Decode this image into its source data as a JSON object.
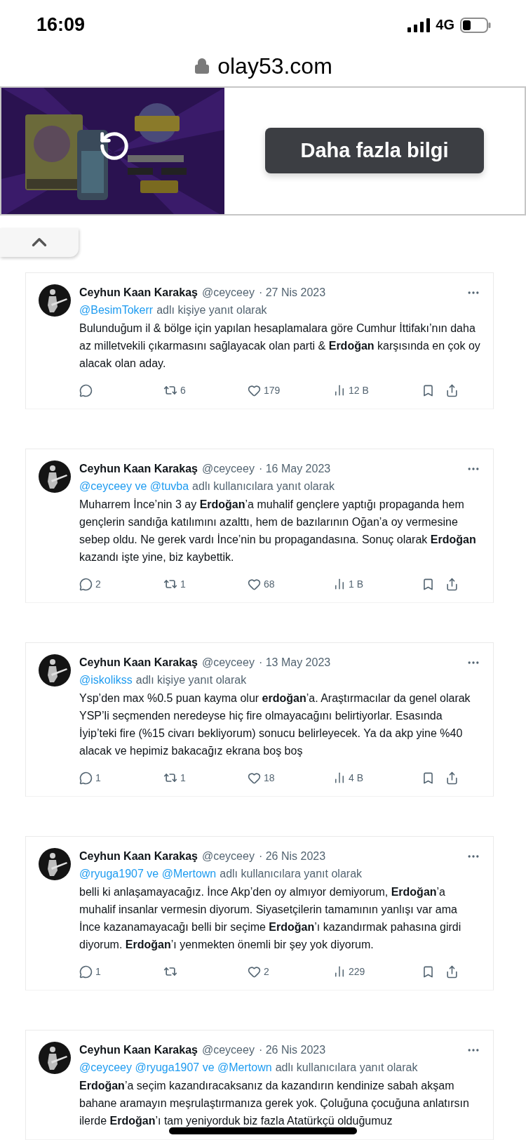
{
  "status_bar": {
    "time": "16:09",
    "network": "4G"
  },
  "address_bar": {
    "url": "olay53.com"
  },
  "ad": {
    "kind": "picture",
    "button": "Daha fazla bilgi"
  },
  "tweets": [
    {
      "name": "Ceyhun Kaan Karakaş",
      "handle": "@ceyceey",
      "date": "· 27 Nis 2023",
      "reply_mentions": "@BesimTokerr",
      "reply_label": "adlı kişiye yanıt olarak",
      "text": "Bulunduğum il & bölge için yapılan hesaplamalara göre Cumhur İttifakı’nın daha az milletvekili çıkarmasını sağlayacak olan parti & **Erdoğan** karşısında en çok oy alacak olan aday.",
      "stats": [
        {
          "kind": "reply"
        },
        {
          "kind": "repost",
          "count": "6"
        },
        {
          "kind": "like",
          "count": "179"
        },
        {
          "kind": "views",
          "count": "12 B"
        },
        {
          "kind": "bookmark"
        },
        {
          "kind": "share"
        }
      ]
    },
    {
      "name": "Ceyhun Kaan Karakaş",
      "handle": "@ceyceey",
      "date": "· 16 May 2023",
      "reply_mentions": "@ceyceey ve @tuvba",
      "reply_label": "adlı kullanıcılara yanıt olarak",
      "text": "Muharrem İnce’nin 3 ay **Erdoğan**’a muhalif gençlere yaptığı propaganda hem gençlerin sandığa katılımını azalttı, hem de bazılarının Oğan’a oy vermesine sebep oldu. Ne gerek vardı İnce’nin bu propagandasına. Sonuç olarak **Erdoğan** kazandı işte yine, biz kaybettik.",
      "stats": [
        {
          "kind": "reply",
          "count": "2"
        },
        {
          "kind": "repost",
          "count": "1"
        },
        {
          "kind": "like",
          "count": "68"
        },
        {
          "kind": "views",
          "count": "1 B"
        },
        {
          "kind": "bookmark"
        },
        {
          "kind": "share"
        }
      ]
    },
    {
      "name": "Ceyhun Kaan Karakaş",
      "handle": "@ceyceey",
      "date": "· 13 May 2023",
      "reply_mentions": "@iskolikss",
      "reply_label": "adlı kişiye yanıt olarak",
      "text": "Ysp’den max %0.5 puan kayma olur **erdoğan**’a. Araştırmacılar da genel olarak YSP’li seçmenden neredeyse hiç fire olmayacağını belirtiyorlar. Esasında İyip’teki fire (%15 civarı bekliyorum) sonucu belirleyecek. Ya da akp yine %40 alacak ve hepimiz bakacağız ekrana boş boş",
      "stats": [
        {
          "kind": "reply",
          "count": "1"
        },
        {
          "kind": "repost",
          "count": "1"
        },
        {
          "kind": "like",
          "count": "18"
        },
        {
          "kind": "views",
          "count": "4 B"
        },
        {
          "kind": "bookmark"
        },
        {
          "kind": "share"
        }
      ]
    },
    {
      "name": "Ceyhun Kaan Karakaş",
      "handle": "@ceyceey",
      "date": "· 26 Nis 2023",
      "reply_mentions": "@ryuga1907 ve @Mertown",
      "reply_label": "adlı kullanıcılara yanıt olarak",
      "text": "belli ki anlaşamayacağız. İnce Akp’den oy almıyor demiyorum, **Erdoğan**’a muhalif insanlar vermesin diyorum. Siyasetçilerin tamamının yanlışı var ama İnce kazanamayacağı belli bir seçime **Erdoğan**’ı kazandırmak pahasına girdi diyorum. **Erdoğan**’ı yenmekten önemli bir şey yok diyorum.",
      "stats": [
        {
          "kind": "reply",
          "count": "1"
        },
        {
          "kind": "repost"
        },
        {
          "kind": "like",
          "count": "2"
        },
        {
          "kind": "views",
          "count": "229"
        },
        {
          "kind": "bookmark"
        },
        {
          "kind": "share"
        }
      ]
    },
    {
      "name": "Ceyhun Kaan Karakaş",
      "handle": "@ceyceey",
      "date": "· 26 Nis 2023",
      "reply_mentions": "@ceyceey @ryuga1907 ve @Mertown",
      "reply_label": "adlı kullanıcılara yanıt olarak",
      "text": "**Erdoğan**’a seçim kazandıracaksanız da kazandırın kendinize sabah akşam bahane aramayın meşrulaştırmanıza gerek yok. Çoluğuna çocuğuna anlatırsın ilerde **Erdoğan**’ı tam yeniyorduk biz fazla Atatürkçü olduğumuz"
    }
  ]
}
